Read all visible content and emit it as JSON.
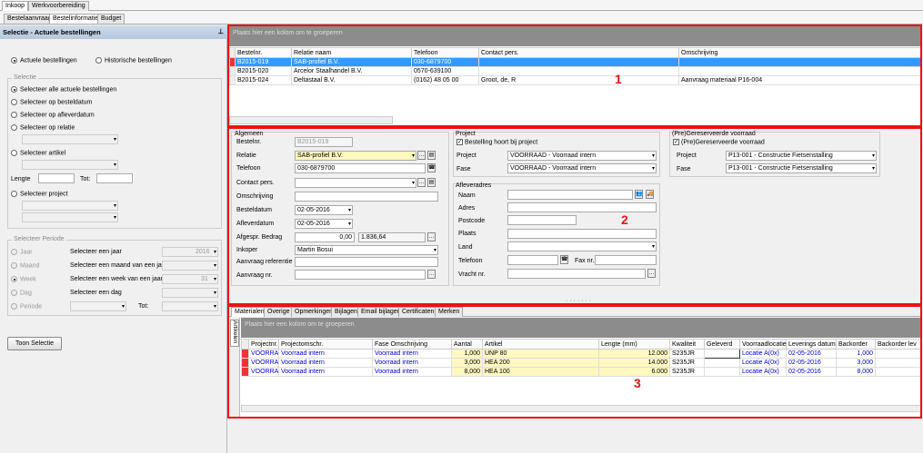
{
  "tabs_top": [
    "Inkoop",
    "Werkvoorbereiding"
  ],
  "tabs_second": [
    "Bestelaanvraag",
    "Bestelinformatie",
    "Budget"
  ],
  "left": {
    "header": "Selectie - Actuele bestellingen",
    "radio_actuele": "Actuele bestellingen",
    "radio_historische": "Historische bestellingen",
    "group_selectie": "Selectie",
    "sel_alle": "Selecteer alle actuele bestellingen",
    "sel_besteldatum": "Selecteer op besteldatum",
    "sel_afleverdatum": "Selecteer op afleverdatum",
    "sel_relatie": "Selecteer op relatie",
    "sel_artikel": "Selecteer artikel",
    "lengte": "Lengte",
    "tot": "Tot:",
    "sel_project": "Selecteer project",
    "group_periode": "Selecteer Periode",
    "periode_rows": [
      {
        "label": "Jaar",
        "desc": "Selecteer een jaar",
        "value": "2016"
      },
      {
        "label": "Maand",
        "desc": "Selecteer een maand van een jaar",
        "value": ""
      },
      {
        "label": "Week",
        "desc": "Selecteer een week van een jaar",
        "value": "31"
      },
      {
        "label": "Dag",
        "desc": "Selecteer een dag",
        "value": ""
      },
      {
        "label": "Periode",
        "desc": "Tot:",
        "value": ""
      }
    ],
    "toon_selectie": "Toon Selectie"
  },
  "top_grid": {
    "group_hint": "Plaats hier een kolom om te groeperen",
    "columns": [
      "Bestelnr.",
      "Relatie naam",
      "Telefoon",
      "Contact pers.",
      "Omschrijving"
    ],
    "rows": [
      [
        "B2015-019",
        "SAB-profiel B.V.",
        "030-6879700",
        "",
        ""
      ],
      [
        "B2015-020",
        "Arcelor Staalhandel B.V.",
        "0570-639100",
        "",
        ""
      ],
      [
        "B2015-024",
        "Deltastaal B.V.",
        "(0162) 48 05 00",
        "Groot, de, R",
        "Aanvraag materiaal P16-004"
      ]
    ],
    "marker": "1"
  },
  "form": {
    "algemeen": "Algemeen",
    "bestelnr_label": "Bestelnr.",
    "bestelnr": "B2015-019",
    "relatie_label": "Relatie",
    "relatie": "SAB-profiel B.V.",
    "telefoon_label": "Telefoon",
    "telefoon": "030-6879700",
    "contact_label": "Contact pers.",
    "omschrijving_label": "Omschrijving",
    "besteldatum_label": "Besteldatum",
    "besteldatum": "02-05-2016",
    "afleverdatum_label": "Afleverdatum",
    "afleverdatum": "02-05-2016",
    "afgespr_label": "Afgespr. Bedrag",
    "afgespr_a": "0,00",
    "afgespr_b": "1.836,64",
    "inkoper_label": "Inkoper",
    "inkoper": "Martin Bosui",
    "aanvraag_ref_label": "Aanvraag referentie",
    "aanvraag_nr_label": "Aanvraag nr.",
    "project_group": "Project",
    "project_chk": "Bestelling hoort bij project",
    "project_label": "Project",
    "project": "VOORRAAD - Voorraad intern",
    "fase_label": "Fase",
    "fase": "VOORRAAD - Voorraad intern",
    "pre_group": "(Pre)Gereserveerde voorraad",
    "pre_chk": "(Pre)Gereserveerde voorraad",
    "pre_project_label": "Project",
    "pre_project": "P13-001 - Constructie Fietsenstalling",
    "pre_fase_label": "Fase",
    "pre_fase": "P13-001 - Constructie Fietsenstalling",
    "aflever_group": "Afleveradres",
    "naam": "Naam",
    "adres": "Adres",
    "postcode": "Postcode",
    "plaats": "Plaats",
    "land": "Land",
    "telefoon2": "Telefoon",
    "fax": "Fax nr.",
    "vracht": "Vracht nr.",
    "marker": "2"
  },
  "bottom_tabs": [
    "Materialen",
    "Overige",
    "Opmerkingen",
    "Bijlagen",
    "Email bijlagen",
    "Certificaten",
    "Merken"
  ],
  "bottom_grid": {
    "side_tab": "Artikelen",
    "group_hint": "Plaats hier een kolom om te groeperen",
    "columns": [
      "Projectnr.",
      "Projectomschr.",
      "Fase Omschrijving",
      "Aantal",
      "Artikel",
      "Lengte (mm)",
      "Kwaliteit",
      "Geleverd",
      "Voorraadlocatie",
      "Leverings datum",
      "Backorder",
      "Backorder lev"
    ],
    "rows": [
      [
        "VOORRAAD",
        "Voorraad intern",
        "Voorraad intern",
        "1,000",
        "UNP  80",
        "12.000",
        "S235JR",
        "",
        "Locatie A(0x)",
        "02-05-2016",
        "1,000",
        ""
      ],
      [
        "VOORRAAD",
        "Voorraad intern",
        "Voorraad intern",
        "3,000",
        "HEA  200",
        "14.000",
        "S235JR",
        "",
        "Locatie A(0x)",
        "02-05-2016",
        "3,000",
        ""
      ],
      [
        "VOORRAAD",
        "Voorraad intern",
        "Voorraad intern",
        "8,000",
        "HEA  100",
        "6.000",
        "S235JR",
        "",
        "Locatie A(0x)",
        "02-05-2016",
        "8,000",
        ""
      ]
    ],
    "marker": "3"
  },
  "colors": {
    "accent_red": "#e11111",
    "selection": "#3399ff",
    "header_bar": "#8c8c8c"
  }
}
